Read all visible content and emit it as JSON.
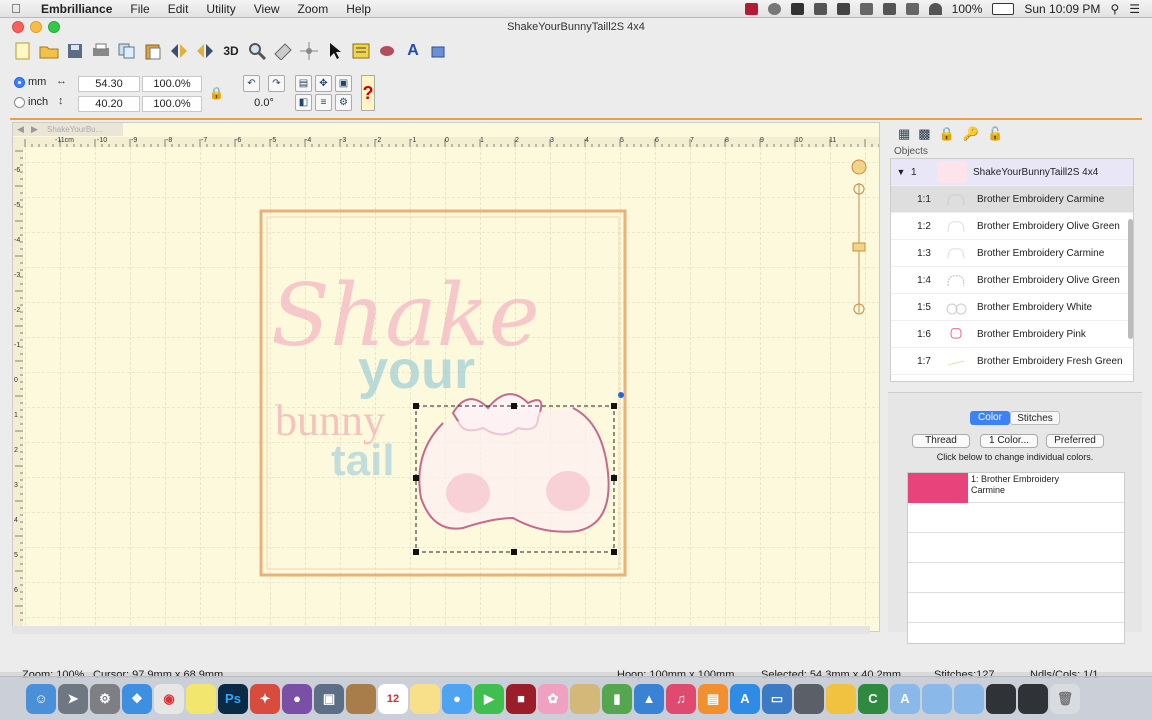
{
  "menubar": {
    "apple": "",
    "items": [
      "Embrilliance",
      "File",
      "Edit",
      "Utility",
      "View",
      "Zoom",
      "Help"
    ],
    "battery": "100%",
    "clock": "Sun 10:09 PM"
  },
  "window": {
    "title": "ShakeYourBunnyTaill2S 4x4"
  },
  "toolbar": {
    "threed_label": "3D"
  },
  "props": {
    "mm_label": "mm",
    "inch_label": "inch",
    "width_value": "54.30",
    "height_value": "40.20",
    "width_pct": "100.0%",
    "height_pct": "100.0%",
    "rotation": "0.0°"
  },
  "canvas": {
    "tab_label": "ShakeYourBu...",
    "ruler_labels": [
      "-11cm",
      "-10",
      "-9",
      "-8",
      "-7",
      "-6",
      "-5",
      "-4",
      "-3",
      "-2",
      "-1",
      "0",
      "1",
      "2",
      "3",
      "4",
      "5",
      "6",
      "7",
      "8",
      "9",
      "10",
      "11"
    ],
    "left_ruler_labels": [
      "-6",
      "-5",
      "-4",
      "-3",
      "-2",
      "-1",
      "0",
      "1",
      "2",
      "3",
      "4",
      "5",
      "6"
    ],
    "design_text": {
      "shake": "Shake",
      "your": "your",
      "bunny": "bunny",
      "tail": "tail"
    }
  },
  "objects": {
    "header": "Objects",
    "parent": {
      "index": "1",
      "name": "ShakeYourBunnyTaill2S 4x4"
    },
    "items": [
      {
        "index": "1:1",
        "name": "Brother Embroidery Carmine",
        "selected": true
      },
      {
        "index": "1:2",
        "name": "Brother Embroidery Olive Green",
        "selected": false
      },
      {
        "index": "1:3",
        "name": "Brother Embroidery Carmine",
        "selected": false
      },
      {
        "index": "1:4",
        "name": "Brother Embroidery Olive Green",
        "selected": false
      },
      {
        "index": "1:5",
        "name": "Brother Embroidery White",
        "selected": false
      },
      {
        "index": "1:6",
        "name": "Brother Embroidery Pink",
        "selected": false
      },
      {
        "index": "1:7",
        "name": "Brother Embroidery Fresh Green",
        "selected": false
      }
    ]
  },
  "colorpanel": {
    "tabs": [
      "Color",
      "Stitches"
    ],
    "buttons": [
      "Thread",
      "1 Color...",
      "Preferred"
    ],
    "hint": "Click below to change individual colors.",
    "swatches": [
      {
        "label": "1: Brother Embroidery Carmine",
        "color": "#e8437a"
      }
    ]
  },
  "status": {
    "zoom": "Zoom: 100%",
    "cursor": "Cursor: 97.9mm x 68.9mm",
    "hoop": "Hoop: 100mm x 100mm",
    "selected": "Selected: 54.3mm x 40.2mm",
    "stitches": "Stitches:127",
    "ndls": "Ndls/Cols: 1/1"
  },
  "colors": {
    "accent": "#3b82f6",
    "canvas_bg": "#fdf9dc",
    "hoop": "#e8b27a",
    "carmine": "#e8437a"
  }
}
